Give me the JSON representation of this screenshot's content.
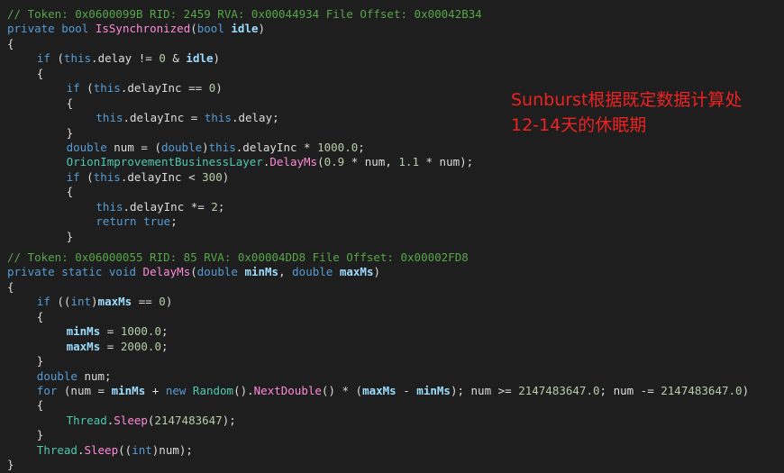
{
  "annotation": {
    "line1": "Sunburst根据既定数据计算处",
    "line2": "12-14天的休眠期"
  },
  "code_blocks": [
    {
      "lines": [
        {
          "indent": 1,
          "segments": [
            {
              "t": "// Token: 0x0600099B RID: 2459 RVA: 0x00044934 File Offset: 0x00042B34",
              "c": "comment"
            }
          ]
        },
        {
          "indent": 1,
          "segments": [
            {
              "t": "private",
              "c": "kw"
            },
            {
              "t": " ",
              "c": "plain"
            },
            {
              "t": "bool",
              "c": "kw"
            },
            {
              "t": " ",
              "c": "plain"
            },
            {
              "t": "IsSynchronized",
              "c": "method"
            },
            {
              "t": "(",
              "c": "plain"
            },
            {
              "t": "bool",
              "c": "kw"
            },
            {
              "t": " ",
              "c": "plain"
            },
            {
              "t": "idle",
              "c": "param"
            },
            {
              "t": ")",
              "c": "plain"
            }
          ]
        },
        {
          "indent": 1,
          "segments": [
            {
              "t": "{",
              "c": "plain"
            }
          ]
        },
        {
          "indent": 5,
          "segments": [
            {
              "t": "if",
              "c": "kw"
            },
            {
              "t": " (",
              "c": "plain"
            },
            {
              "t": "this",
              "c": "kw"
            },
            {
              "t": ".",
              "c": "plain"
            },
            {
              "t": "delay",
              "c": "field"
            },
            {
              "t": " != ",
              "c": "plain"
            },
            {
              "t": "0",
              "c": "num"
            },
            {
              "t": " & ",
              "c": "plain"
            },
            {
              "t": "idle",
              "c": "param"
            },
            {
              "t": ")",
              "c": "plain"
            }
          ]
        },
        {
          "indent": 5,
          "segments": [
            {
              "t": "{",
              "c": "plain"
            }
          ]
        },
        {
          "indent": 9,
          "segments": [
            {
              "t": "if",
              "c": "kw"
            },
            {
              "t": " (",
              "c": "plain"
            },
            {
              "t": "this",
              "c": "kw"
            },
            {
              "t": ".",
              "c": "plain"
            },
            {
              "t": "delayInc",
              "c": "field"
            },
            {
              "t": " == ",
              "c": "plain"
            },
            {
              "t": "0",
              "c": "num"
            },
            {
              "t": ")",
              "c": "plain"
            }
          ]
        },
        {
          "indent": 9,
          "segments": [
            {
              "t": "{",
              "c": "plain"
            }
          ]
        },
        {
          "indent": 13,
          "segments": [
            {
              "t": "this",
              "c": "kw"
            },
            {
              "t": ".",
              "c": "plain"
            },
            {
              "t": "delayInc",
              "c": "field"
            },
            {
              "t": " = ",
              "c": "plain"
            },
            {
              "t": "this",
              "c": "kw"
            },
            {
              "t": ".",
              "c": "plain"
            },
            {
              "t": "delay",
              "c": "field"
            },
            {
              "t": ";",
              "c": "plain"
            }
          ]
        },
        {
          "indent": 9,
          "segments": [
            {
              "t": "}",
              "c": "plain"
            }
          ]
        },
        {
          "indent": 9,
          "segments": [
            {
              "t": "double",
              "c": "kw"
            },
            {
              "t": " num = (",
              "c": "plain"
            },
            {
              "t": "double",
              "c": "kw"
            },
            {
              "t": ")",
              "c": "plain"
            },
            {
              "t": "this",
              "c": "kw"
            },
            {
              "t": ".",
              "c": "plain"
            },
            {
              "t": "delayInc",
              "c": "field"
            },
            {
              "t": " * ",
              "c": "plain"
            },
            {
              "t": "1000.0",
              "c": "num"
            },
            {
              "t": ";",
              "c": "plain"
            }
          ]
        },
        {
          "indent": 9,
          "segments": [
            {
              "t": "OrionImprovementBusinessLayer",
              "c": "class"
            },
            {
              "t": ".",
              "c": "plain"
            },
            {
              "t": "DelayMs",
              "c": "method"
            },
            {
              "t": "(",
              "c": "plain"
            },
            {
              "t": "0.9",
              "c": "num"
            },
            {
              "t": " * num, ",
              "c": "plain"
            },
            {
              "t": "1.1",
              "c": "num"
            },
            {
              "t": " * num);",
              "c": "plain"
            }
          ]
        },
        {
          "indent": 9,
          "segments": [
            {
              "t": "if",
              "c": "kw"
            },
            {
              "t": " (",
              "c": "plain"
            },
            {
              "t": "this",
              "c": "kw"
            },
            {
              "t": ".",
              "c": "plain"
            },
            {
              "t": "delayInc",
              "c": "field"
            },
            {
              "t": " < ",
              "c": "plain"
            },
            {
              "t": "300",
              "c": "num"
            },
            {
              "t": ")",
              "c": "plain"
            }
          ]
        },
        {
          "indent": 9,
          "segments": [
            {
              "t": "{",
              "c": "plain"
            }
          ]
        },
        {
          "indent": 13,
          "segments": [
            {
              "t": "this",
              "c": "kw"
            },
            {
              "t": ".",
              "c": "plain"
            },
            {
              "t": "delayInc",
              "c": "field"
            },
            {
              "t": " *= ",
              "c": "plain"
            },
            {
              "t": "2",
              "c": "num"
            },
            {
              "t": ";",
              "c": "plain"
            }
          ]
        },
        {
          "indent": 13,
          "segments": [
            {
              "t": "return",
              "c": "kw"
            },
            {
              "t": " ",
              "c": "plain"
            },
            {
              "t": "true",
              "c": "kw"
            },
            {
              "t": ";",
              "c": "plain"
            }
          ]
        },
        {
          "indent": 9,
          "segments": [
            {
              "t": "}",
              "c": "plain"
            }
          ]
        }
      ]
    },
    {
      "lines": [
        {
          "indent": 1,
          "segments": [
            {
              "t": "// Token: 0x06000055 RID: 85 RVA: 0x00004DD8 File Offset: 0x00002FD8",
              "c": "comment"
            }
          ]
        },
        {
          "indent": 1,
          "segments": [
            {
              "t": "private",
              "c": "kw"
            },
            {
              "t": " ",
              "c": "plain"
            },
            {
              "t": "static",
              "c": "kw"
            },
            {
              "t": " ",
              "c": "plain"
            },
            {
              "t": "void",
              "c": "kw"
            },
            {
              "t": " ",
              "c": "plain"
            },
            {
              "t": "DelayMs",
              "c": "method"
            },
            {
              "t": "(",
              "c": "plain"
            },
            {
              "t": "double",
              "c": "kw"
            },
            {
              "t": " ",
              "c": "plain"
            },
            {
              "t": "minMs",
              "c": "param"
            },
            {
              "t": ", ",
              "c": "plain"
            },
            {
              "t": "double",
              "c": "kw"
            },
            {
              "t": " ",
              "c": "plain"
            },
            {
              "t": "maxMs",
              "c": "param"
            },
            {
              "t": ")",
              "c": "plain"
            }
          ]
        },
        {
          "indent": 1,
          "segments": [
            {
              "t": "{",
              "c": "plain"
            }
          ]
        },
        {
          "indent": 5,
          "segments": [
            {
              "t": "if",
              "c": "kw"
            },
            {
              "t": " ((",
              "c": "plain"
            },
            {
              "t": "int",
              "c": "kw"
            },
            {
              "t": ")",
              "c": "plain"
            },
            {
              "t": "maxMs",
              "c": "param"
            },
            {
              "t": " == ",
              "c": "plain"
            },
            {
              "t": "0",
              "c": "num"
            },
            {
              "t": ")",
              "c": "plain"
            }
          ]
        },
        {
          "indent": 5,
          "segments": [
            {
              "t": "{",
              "c": "plain"
            }
          ]
        },
        {
          "indent": 9,
          "segments": [
            {
              "t": "minMs",
              "c": "param"
            },
            {
              "t": " = ",
              "c": "plain"
            },
            {
              "t": "1000.0",
              "c": "num"
            },
            {
              "t": ";",
              "c": "plain"
            }
          ]
        },
        {
          "indent": 9,
          "segments": [
            {
              "t": "maxMs",
              "c": "param"
            },
            {
              "t": " = ",
              "c": "plain"
            },
            {
              "t": "2000.0",
              "c": "num"
            },
            {
              "t": ";",
              "c": "plain"
            }
          ]
        },
        {
          "indent": 5,
          "segments": [
            {
              "t": "}",
              "c": "plain"
            }
          ]
        },
        {
          "indent": 5,
          "segments": [
            {
              "t": "double",
              "c": "kw"
            },
            {
              "t": " num;",
              "c": "plain"
            }
          ]
        },
        {
          "indent": 5,
          "segments": [
            {
              "t": "for",
              "c": "kw"
            },
            {
              "t": " (num = ",
              "c": "plain"
            },
            {
              "t": "minMs",
              "c": "param"
            },
            {
              "t": " + ",
              "c": "plain"
            },
            {
              "t": "new",
              "c": "kw"
            },
            {
              "t": " ",
              "c": "plain"
            },
            {
              "t": "Random",
              "c": "class"
            },
            {
              "t": "().",
              "c": "plain"
            },
            {
              "t": "NextDouble",
              "c": "method"
            },
            {
              "t": "() * (",
              "c": "plain"
            },
            {
              "t": "maxMs",
              "c": "param"
            },
            {
              "t": " - ",
              "c": "plain"
            },
            {
              "t": "minMs",
              "c": "param"
            },
            {
              "t": "); num >= ",
              "c": "plain"
            },
            {
              "t": "2147483647.0",
              "c": "num"
            },
            {
              "t": "; num -= ",
              "c": "plain"
            },
            {
              "t": "2147483647.0",
              "c": "num"
            },
            {
              "t": ")",
              "c": "plain"
            }
          ]
        },
        {
          "indent": 5,
          "segments": [
            {
              "t": "{",
              "c": "plain"
            }
          ]
        },
        {
          "indent": 9,
          "segments": [
            {
              "t": "Thread",
              "c": "class"
            },
            {
              "t": ".",
              "c": "plain"
            },
            {
              "t": "Sleep",
              "c": "method"
            },
            {
              "t": "(",
              "c": "plain"
            },
            {
              "t": "2147483647",
              "c": "num"
            },
            {
              "t": ");",
              "c": "plain"
            }
          ]
        },
        {
          "indent": 5,
          "segments": [
            {
              "t": "}",
              "c": "plain"
            }
          ]
        },
        {
          "indent": 5,
          "segments": [
            {
              "t": "Thread",
              "c": "class"
            },
            {
              "t": ".",
              "c": "plain"
            },
            {
              "t": "Sleep",
              "c": "method"
            },
            {
              "t": "((",
              "c": "plain"
            },
            {
              "t": "int",
              "c": "kw"
            },
            {
              "t": ")num);",
              "c": "plain"
            }
          ]
        },
        {
          "indent": 1,
          "segments": [
            {
              "t": "}",
              "c": "plain"
            }
          ]
        }
      ]
    }
  ]
}
